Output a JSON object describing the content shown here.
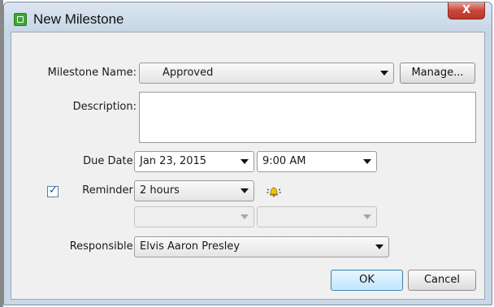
{
  "window": {
    "title": "New Milestone",
    "close_glyph": "X"
  },
  "form": {
    "milestone_name": {
      "label": "Milestone Name:",
      "value": "Approved"
    },
    "manage_button": "Manage...",
    "description": {
      "label": "Description:",
      "value": ""
    },
    "due_date": {
      "label": "Due Date:",
      "date": "Jan 23, 2015",
      "time": "9:00 AM"
    },
    "reminder": {
      "label": "Reminder:",
      "checked": true,
      "check_glyph": "✓",
      "value": "2 hours",
      "icon": "alarm-bell-icon"
    },
    "extra_row": {
      "left": "",
      "right": ""
    },
    "responsible": {
      "label": "Responsible:",
      "value": "Elvis Aaron Presley"
    }
  },
  "buttons": {
    "ok": "OK",
    "cancel": "Cancel"
  },
  "colors": {
    "titlebar": "#c9d7e6",
    "close": "#c7483a",
    "ok_border": "#3c7fb1"
  }
}
